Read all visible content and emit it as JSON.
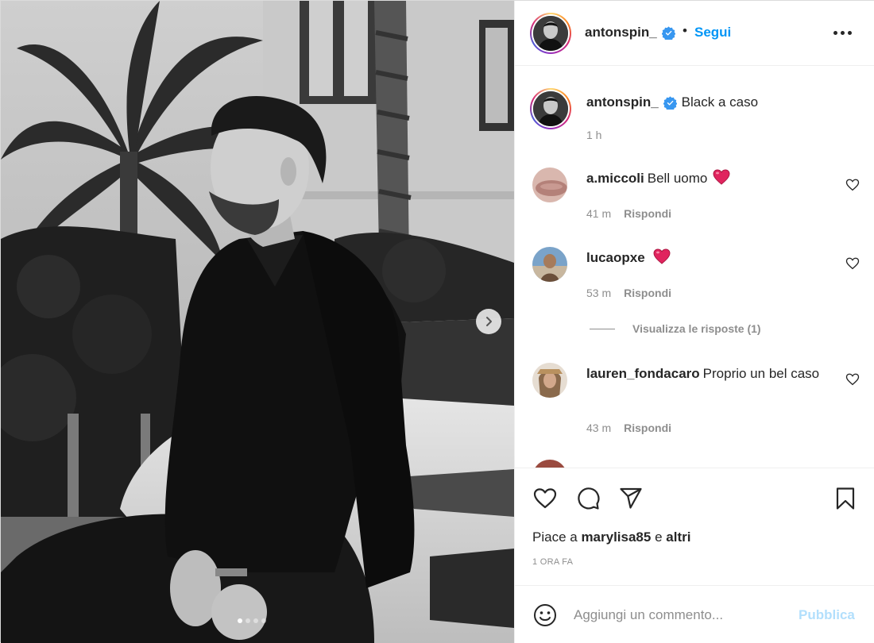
{
  "post": {
    "author": "antonspin_",
    "follow_label": "Segui",
    "separator": "•",
    "caption": "Black a caso",
    "caption_time": "1 h"
  },
  "carousel": {
    "slides": 4,
    "active_slide": 1
  },
  "comments": [
    {
      "user": "a.miccoli",
      "text": "Bell uomo",
      "emoji": "heart",
      "time": "41 m",
      "reply_label": "Rispondi"
    },
    {
      "user": "lucaopxe",
      "text": "",
      "emoji": "heart",
      "time": "53 m",
      "reply_label": "Rispondi"
    },
    {
      "user": "lauren_fondacaro",
      "text": "Proprio un bel caso",
      "emoji": "",
      "time": "43 m",
      "reply_label": "Rispondi"
    }
  ],
  "view_replies_label": "Visualizza le risposte (1)",
  "likes": {
    "prefix": "Piace a",
    "user": "marylisa85",
    "joiner": "e",
    "others": "altri"
  },
  "post_date": "1 ORA FA",
  "composer": {
    "placeholder": "Aggiungi un commento...",
    "publish_label": "Pubblica"
  },
  "icons": {
    "verified": "verified-badge-icon",
    "more": "more-options-icon",
    "like": "heart-outline-icon",
    "comment": "comment-bubble-icon",
    "share": "paper-plane-icon",
    "save": "bookmark-icon",
    "emoji": "smiley-face-icon",
    "next": "chevron-right-icon"
  },
  "colors": {
    "accent": "#0095f6",
    "publish_disabled": "#b2dffc",
    "secondary_text": "#8e8e8e",
    "heart_emoji": "#e0245e",
    "verified": "#3897f0"
  }
}
